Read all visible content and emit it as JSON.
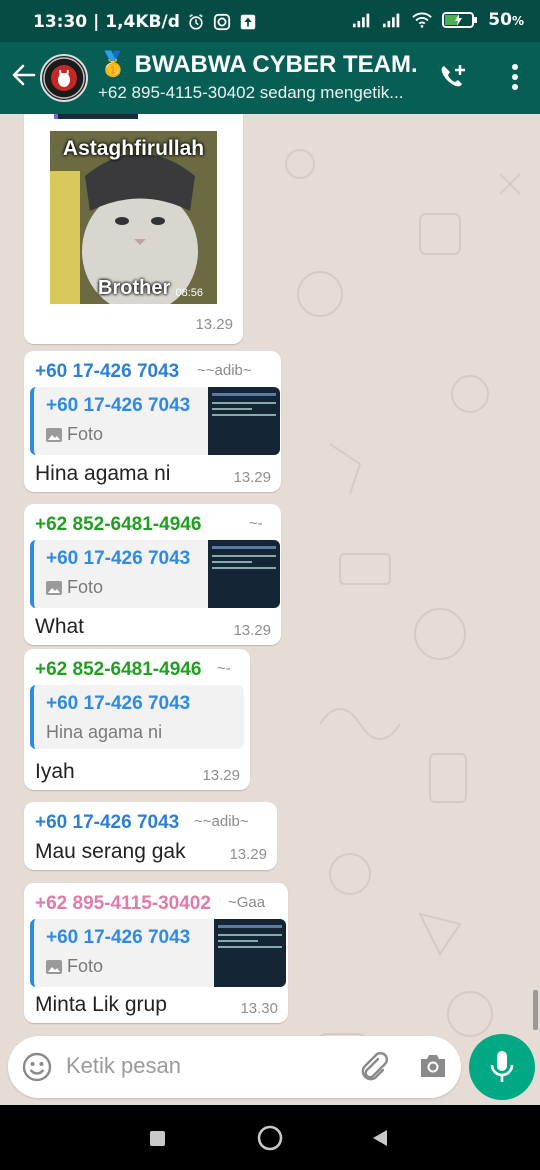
{
  "status_bar": {
    "time": "13:30",
    "speed": "| 1,4KB/d",
    "battery": "50",
    "battery_unit": "%"
  },
  "header": {
    "title_emoji": "🥇",
    "title": "BWABWA CYBER TEAM...",
    "subtitle": "+62 895-4115-30402 sedang mengetik..."
  },
  "sticker_message": {
    "top_text": "Astaghfirullah",
    "bottom_text": "Brother",
    "inner_time": "08:56",
    "time": "13.29"
  },
  "messages": [
    {
      "sender": "+60 17-426 7043",
      "sender_color": "#2e7fd4",
      "alias": "~~adib~",
      "quote_sender": "+60 17-426 7043",
      "quote_text": "Foto",
      "quote_has_image": true,
      "text": "Hina agama ni",
      "time": "13.29"
    },
    {
      "sender": "+62 852-6481-4946",
      "sender_color": "#20a020",
      "alias": "~-",
      "quote_sender": "+60 17-426 7043",
      "quote_text": "Foto",
      "quote_has_image": true,
      "text": "What",
      "time": "13.29"
    },
    {
      "sender": "+62 852-6481-4946",
      "sender_color": "#20a020",
      "alias": "~-",
      "quote_sender": "+60 17-426 7043",
      "quote_text": "Hina agama ni",
      "quote_has_image": false,
      "text": "Iyah",
      "time": "13.29"
    },
    {
      "sender": "+60 17-426 7043",
      "sender_color": "#2e7fd4",
      "alias": "~~adib~",
      "text": "Mau serang gak",
      "time": "13.29"
    },
    {
      "sender": "+62 895-4115-30402",
      "sender_color": "#e07aa8",
      "alias": "~Gaa",
      "quote_sender": "+60 17-426 7043",
      "quote_text": "Foto",
      "quote_has_image": true,
      "text": "Minta Lik grup",
      "time": "13.30"
    }
  ],
  "input": {
    "placeholder": "Ketik pesan"
  },
  "colors": {
    "header": "#075e54",
    "status_bar": "#054d44",
    "accent_green": "#00a884",
    "quote_bar": "#2e8be0"
  }
}
